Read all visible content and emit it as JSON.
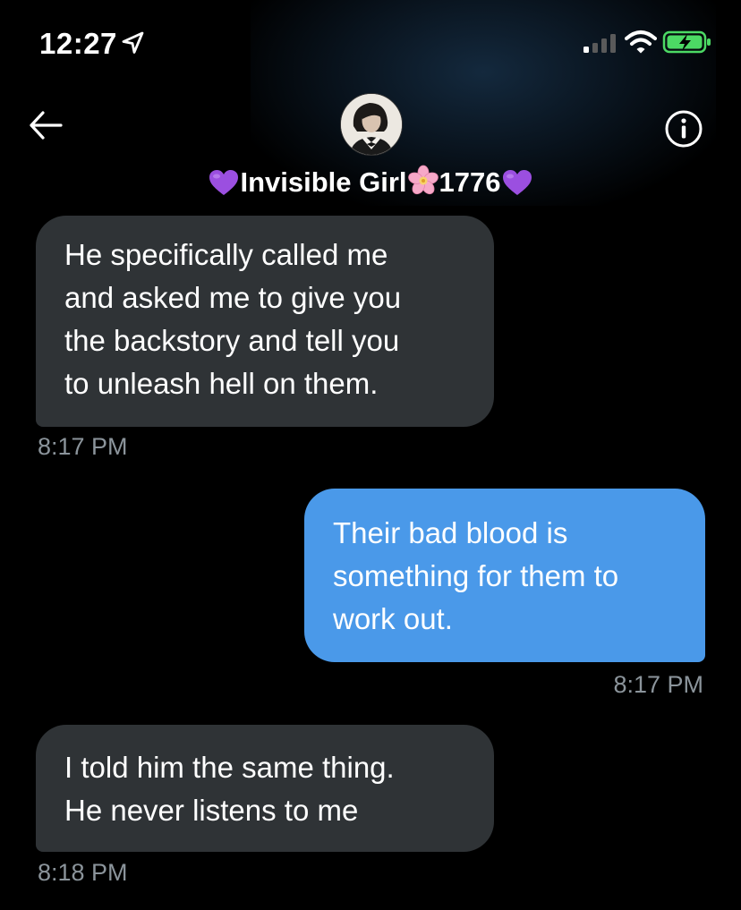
{
  "status_bar": {
    "time": "12:27"
  },
  "header": {
    "contact_name": "Invisible Girl",
    "contact_number": "1776"
  },
  "messages": [
    {
      "direction": "incoming",
      "lines": [
        "He specifically called me",
        "and asked me to give you",
        "the backstory and tell you",
        "to unleash hell on them."
      ],
      "time": "8:17 PM"
    },
    {
      "direction": "outgoing",
      "lines": [
        "Their bad blood is",
        "something for them to",
        "work out."
      ],
      "time": "8:17 PM"
    },
    {
      "direction": "incoming",
      "lines": [
        "I told him the same thing.",
        "He never listens to me"
      ],
      "time": "8:18 PM"
    }
  ],
  "icons": {
    "back": "arrow-left-icon",
    "info": "info-icon",
    "location": "location-arrow-icon",
    "signal": "cellular-signal-icon",
    "wifi": "wifi-icon",
    "battery": "battery-charging-icon",
    "heart": "purple-heart-emoji",
    "flower": "cherry-blossom-emoji"
  },
  "colors": {
    "background": "#000000",
    "incoming_bubble": "#2f3336",
    "outgoing_bubble": "#4a99e9",
    "timestamp": "#8b949b",
    "battery_green": "#4cd964",
    "heart_purple": "#9b4fe0",
    "flower_pink": "#f6a8c8"
  }
}
